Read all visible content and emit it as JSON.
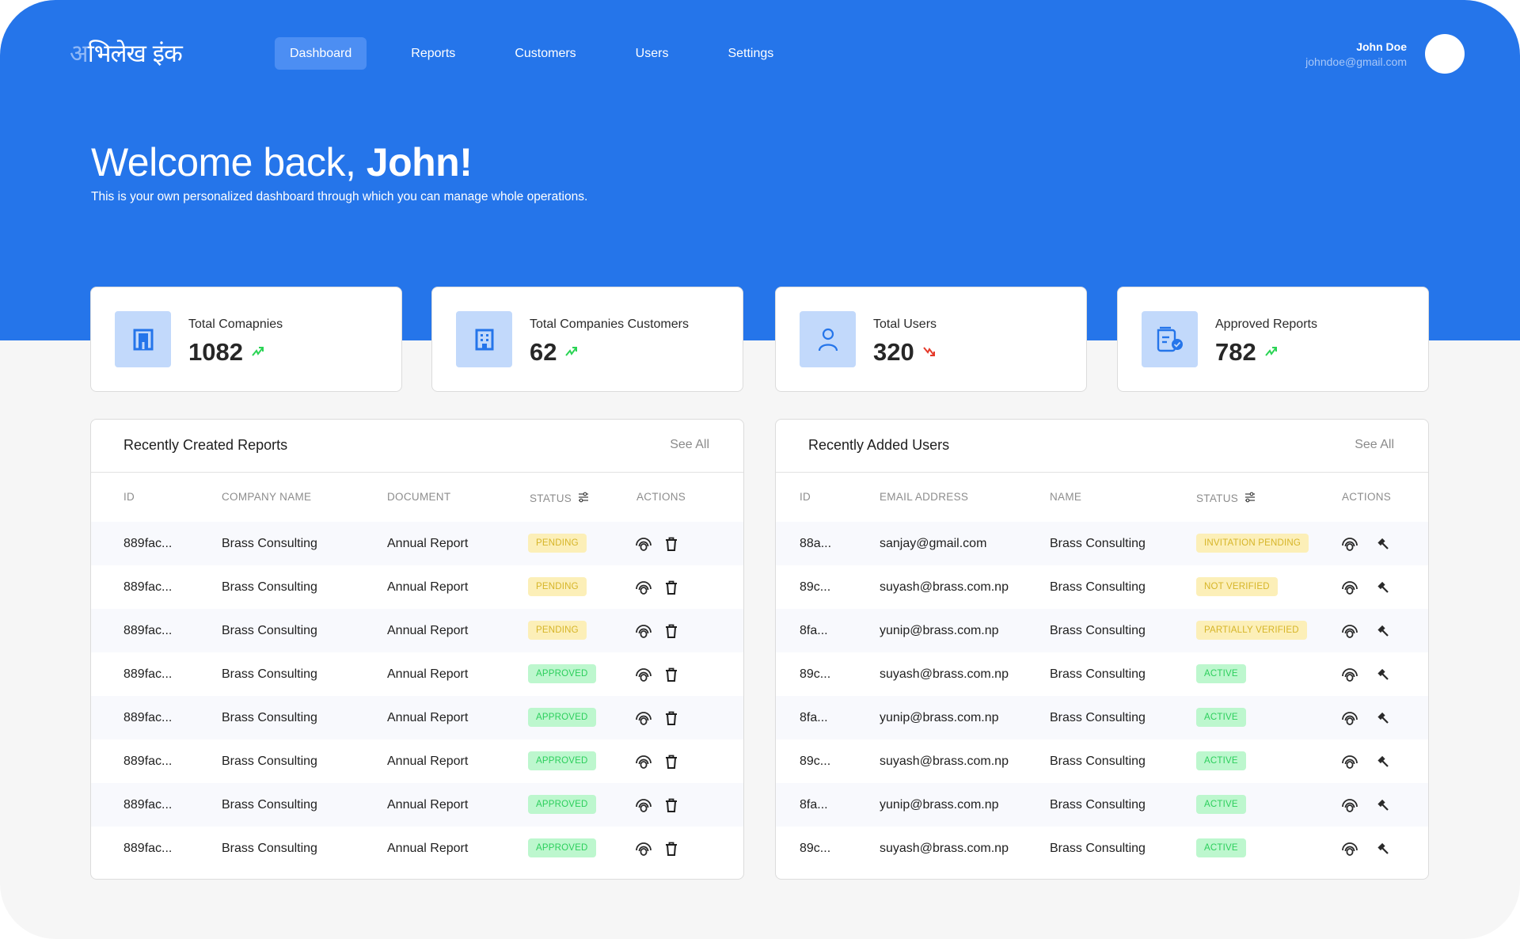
{
  "brand": {
    "logo_first": "अ",
    "logo_rest": "भिलेख इंक"
  },
  "nav": {
    "items": [
      {
        "label": "Dashboard",
        "active": true
      },
      {
        "label": "Reports",
        "active": false
      },
      {
        "label": "Customers",
        "active": false
      },
      {
        "label": "Users",
        "active": false
      },
      {
        "label": "Settings",
        "active": false
      }
    ]
  },
  "user": {
    "name": "John Doe",
    "email": "johndoe@gmail.com",
    "avatar_icon": "avatar-circle"
  },
  "welcome": {
    "prefix": "Welcome back, ",
    "name": "John!",
    "subtitle": "This is your own personalized dashboard through which you can manage whole operations."
  },
  "stats": [
    {
      "label": "Total Comapnies",
      "value": "1082",
      "trend": "up",
      "icon": "building-icon"
    },
    {
      "label": "Total Companies Customers",
      "value": "62",
      "trend": "up",
      "icon": "office-building-icon"
    },
    {
      "label": "Total Users",
      "value": "320",
      "trend": "down",
      "icon": "user-icon"
    },
    {
      "label": "Approved Reports",
      "value": "782",
      "trend": "up",
      "icon": "approved-document-icon"
    }
  ],
  "colors": {
    "brand_blue": "#2575ea",
    "trend_up": "#2bd455",
    "trend_down": "#e53a2a",
    "badge_warning_bg": "#fcefb8",
    "badge_warning_text": "#d6b528",
    "badge_success_bg": "#bdf7ce",
    "badge_success_text": "#2ccf5c"
  },
  "reports": {
    "title": "Recently Created Reports",
    "see_all": "See All",
    "columns": [
      "ID",
      "COMPANY NAME",
      "DOCUMENT",
      "STATUS",
      "ACTIONS"
    ],
    "rows": [
      {
        "id": "889fac...",
        "company": "Brass Consulting",
        "document": "Annual Report",
        "status": "PENDING",
        "type": "warn"
      },
      {
        "id": "889fac...",
        "company": "Brass Consulting",
        "document": "Annual Report",
        "status": "PENDING",
        "type": "warn"
      },
      {
        "id": "889fac...",
        "company": "Brass Consulting",
        "document": "Annual Report",
        "status": "PENDING",
        "type": "warn"
      },
      {
        "id": "889fac...",
        "company": "Brass Consulting",
        "document": "Annual Report",
        "status": "APPROVED",
        "type": "ok"
      },
      {
        "id": "889fac...",
        "company": "Brass Consulting",
        "document": "Annual Report",
        "status": "APPROVED",
        "type": "ok"
      },
      {
        "id": "889fac...",
        "company": "Brass Consulting",
        "document": "Annual Report",
        "status": "APPROVED",
        "type": "ok"
      },
      {
        "id": "889fac...",
        "company": "Brass Consulting",
        "document": "Annual Report",
        "status": "APPROVED",
        "type": "ok"
      },
      {
        "id": "889fac...",
        "company": "Brass Consulting",
        "document": "Annual Report",
        "status": "APPROVED",
        "type": "ok"
      }
    ]
  },
  "users": {
    "title": "Recently Added Users",
    "see_all": "See All",
    "columns": [
      "ID",
      "EMAIL ADDRESS",
      "NAME",
      "STATUS",
      "ACTIONS"
    ],
    "rows": [
      {
        "id": "88a...",
        "email": "sanjay@gmail.com",
        "name": "Brass Consulting",
        "status": "INVITATION PENDING",
        "type": "warn"
      },
      {
        "id": "89c...",
        "email": "suyash@brass.com.np",
        "name": "Brass Consulting",
        "status": "NOT VERIFIED",
        "type": "warn"
      },
      {
        "id": "8fa...",
        "email": "yunip@brass.com.np",
        "name": "Brass Consulting",
        "status": "PARTIALLY VERIFIED",
        "type": "warn"
      },
      {
        "id": "89c...",
        "email": "suyash@brass.com.np",
        "name": "Brass Consulting",
        "status": "ACTIVE",
        "type": "ok"
      },
      {
        "id": "8fa...",
        "email": "yunip@brass.com.np",
        "name": "Brass Consulting",
        "status": "ACTIVE",
        "type": "ok"
      },
      {
        "id": "89c...",
        "email": "suyash@brass.com.np",
        "name": "Brass Consulting",
        "status": "ACTIVE",
        "type": "ok"
      },
      {
        "id": "8fa...",
        "email": "yunip@brass.com.np",
        "name": "Brass Consulting",
        "status": "ACTIVE",
        "type": "ok"
      },
      {
        "id": "89c...",
        "email": "suyash@brass.com.np",
        "name": "Brass Consulting",
        "status": "ACTIVE",
        "type": "ok"
      }
    ]
  }
}
